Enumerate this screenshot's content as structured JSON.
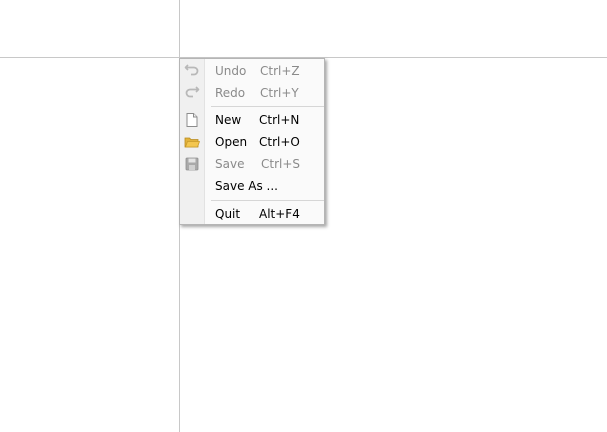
{
  "menu": {
    "items": [
      {
        "label": "Undo",
        "shortcut": "Ctrl+Z",
        "icon": "undo-icon",
        "enabled": false
      },
      {
        "label": "Redo",
        "shortcut": "Ctrl+Y",
        "icon": "redo-icon",
        "enabled": false
      },
      {
        "label": "New",
        "shortcut": "Ctrl+N",
        "icon": "new-document-icon",
        "enabled": true
      },
      {
        "label": "Open",
        "shortcut": "Ctrl+O",
        "icon": "folder-open-icon",
        "enabled": true
      },
      {
        "label": "Save",
        "shortcut": "Ctrl+S",
        "icon": "save-disk-icon",
        "enabled": false
      },
      {
        "label": "Save As ...",
        "shortcut": "",
        "icon": "",
        "enabled": true
      },
      {
        "label": "Quit",
        "shortcut": "Alt+F4",
        "icon": "",
        "enabled": true
      }
    ]
  },
  "colors": {
    "menu_background": "#fafafa",
    "disabled_text": "#8a8a8a",
    "folder_icon": "#f3c64f"
  }
}
